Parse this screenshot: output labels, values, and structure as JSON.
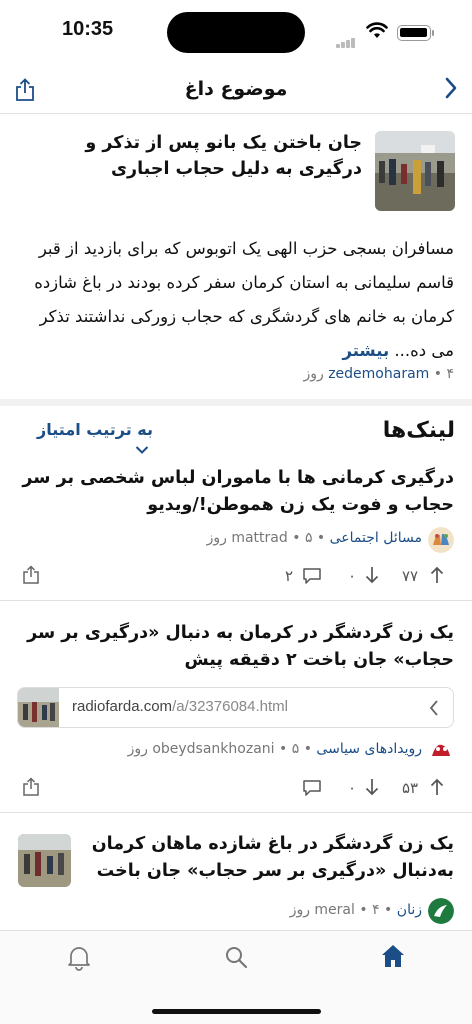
{
  "status": {
    "time": "10:35"
  },
  "header": {
    "title": "موضوع داغ"
  },
  "featured": {
    "title": "جان باختن یک بانو پس از تذکر و درگیری به دلیل حجاب اجباری",
    "body": "مسافران بسجی حزب الهی یک اتوبوس که برای بازدید از قبر قاسم سلیمانی به استان کرمان سفر کرده بودند در باغ شازده کرمان به خانم های گردشگری که حجاب زورکی نداشتند تذکر می ده...",
    "more": "بیشتر",
    "user": "zedemoharam",
    "age": "۴ روز"
  },
  "links_section": {
    "title": "لینک‌ها",
    "sort_label": "به ترتیب امتیاز"
  },
  "posts": [
    {
      "title": "درگیری کرمانی ها با ماموران لباس شخصی بر سر حجاب و فوت یک زن هموطن!/ویدیو",
      "subreddit": "مسائل اجتماعی",
      "user": "mattrad",
      "age": "۵ روز",
      "upvotes": "۷۷",
      "downvotes": "۰",
      "comments": "۲"
    },
    {
      "title": "یک زن گردشگر در کرمان به دنبال «درگیری بر سر حجاب» جان باخت ۲ دقیقه پیش",
      "link_domain": "radiofarda.com",
      "link_path": "/a/32376084.html",
      "subreddit": "رویدادهای سیاسی",
      "user": "obeydsankhozani",
      "age": "۵ روز",
      "upvotes": "۵۳",
      "downvotes": "۰",
      "comments": ""
    },
    {
      "title": "یک زن گردشگر در باغ شازده ماهان کرمان به‌دنبال «درگیری بر سر حجاب» جان باخت",
      "subreddit": "زنان",
      "user": "meral",
      "age": "۴ روز"
    }
  ],
  "colors": {
    "accent": "#1b4e87",
    "divider": "#e1e1e1"
  },
  "icons": [
    "share-icon",
    "back-chevron-icon",
    "chevron-down-icon",
    "upvote-icon",
    "downvote-icon",
    "comment-icon",
    "bell-icon",
    "search-icon",
    "home-icon"
  ]
}
